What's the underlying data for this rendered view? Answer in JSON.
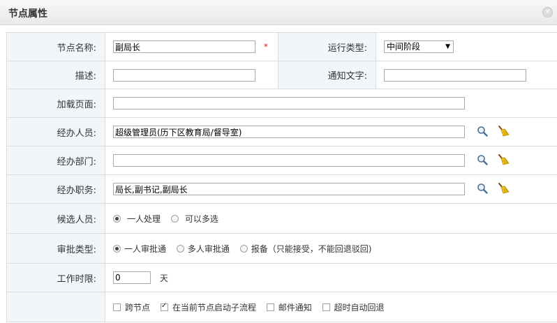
{
  "dialog": {
    "title": "节点属性",
    "close_icon": "close-icon"
  },
  "form": {
    "node_name": {
      "label": "节点名称:",
      "value": "副局长",
      "required_mark": "*"
    },
    "run_type": {
      "label": "运行类型:",
      "selected": "中间阶段"
    },
    "description": {
      "label": "描述:",
      "value": ""
    },
    "notify_text": {
      "label": "通知文字:",
      "value": ""
    },
    "load_page": {
      "label": "加载页面:",
      "value": ""
    },
    "handler_users": {
      "label": "经办人员:",
      "value": "超级管理员(历下区教育局/督导室)"
    },
    "handler_depts": {
      "label": "经办部门:",
      "value": ""
    },
    "handler_posts": {
      "label": "经办职务:",
      "value": "局长,副书记,副局长"
    },
    "candidates": {
      "label": "候选人员:",
      "options": [
        {
          "label": "一人处理",
          "checked": true
        },
        {
          "label": "可以多选",
          "checked": false
        }
      ]
    },
    "approval_type": {
      "label": "审批类型:",
      "options": [
        {
          "label": "一人审批通",
          "checked": true
        },
        {
          "label": "多人审批通",
          "checked": false
        },
        {
          "label": "报备（只能接受，不能回退驳回)",
          "checked": false
        }
      ]
    },
    "time_limit": {
      "label": "工作时限:",
      "value": "0",
      "unit": "天"
    },
    "flags": [
      {
        "label": "跨节点",
        "checked": false
      },
      {
        "label": "在当前节点启动子流程",
        "checked": true
      },
      {
        "label": "邮件通知",
        "checked": false
      },
      {
        "label": "超时自动回退",
        "checked": false
      }
    ]
  },
  "icons": {
    "search": "search-icon",
    "clear": "broom-icon"
  }
}
